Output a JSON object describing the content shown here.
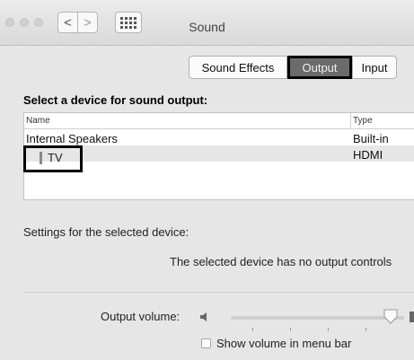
{
  "window": {
    "title": "Sound"
  },
  "toolbar": {
    "back_label": "<",
    "forward_label": ">"
  },
  "tabs": [
    {
      "label": "Sound Effects",
      "selected": false
    },
    {
      "label": "Output",
      "selected": true
    },
    {
      "label": "Input",
      "selected": false
    }
  ],
  "output": {
    "heading": "Select a device for sound output:",
    "columns": {
      "name": "Name",
      "type": "Type"
    },
    "devices": [
      {
        "name": "Internal Speakers",
        "type": "Built-in"
      },
      {
        "name": "TV",
        "type": "HDMI",
        "selected": true
      }
    ],
    "settings_label": "Settings for the selected device:",
    "no_controls_text": "The selected device has no output controls",
    "volume_label": "Output volume:",
    "volume_level": 0.92,
    "show_volume_label": "Show volume in menu bar"
  },
  "colors": {
    "selected_tab": "#6b6b6b",
    "highlight_border": "#000000"
  }
}
